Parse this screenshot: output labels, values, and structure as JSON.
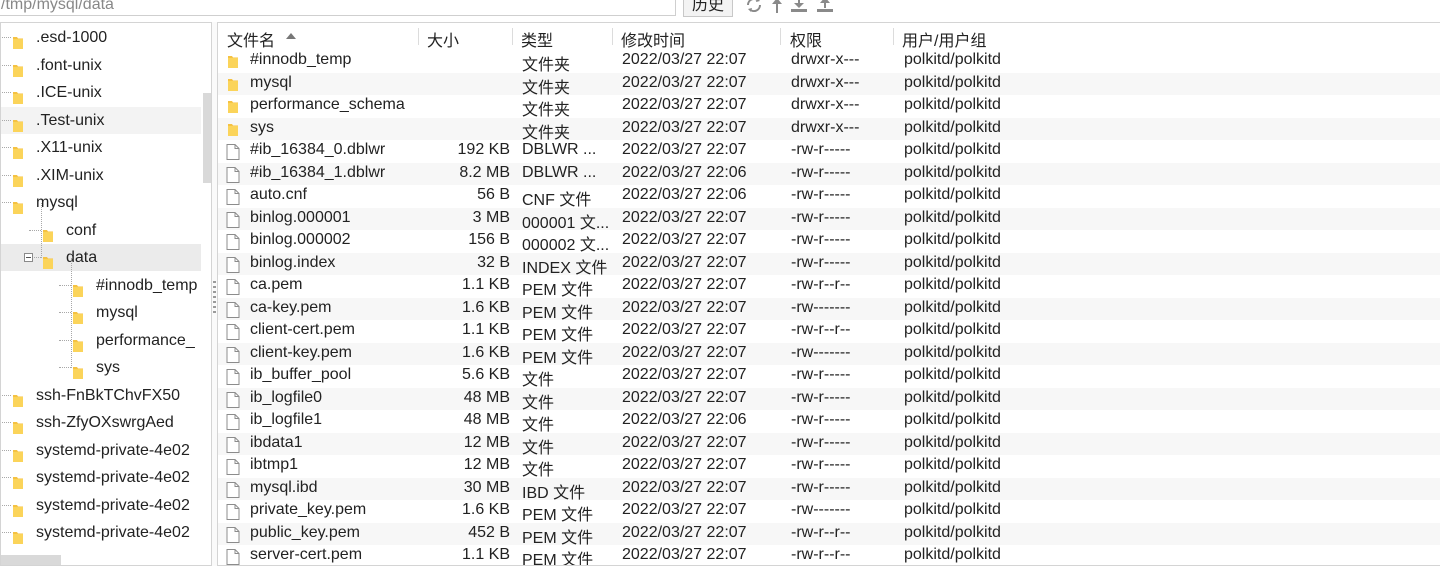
{
  "toolbar": {
    "path": "/tmp/mysql/data",
    "history_label": "历史",
    "icons": [
      "refresh-icon",
      "up-icon",
      "download-icon",
      "upload-icon"
    ]
  },
  "tree": [
    {
      "label": ".esd-1000",
      "depth": 0
    },
    {
      "label": ".font-unix",
      "depth": 0
    },
    {
      "label": ".ICE-unix",
      "depth": 0
    },
    {
      "label": ".Test-unix",
      "depth": 0,
      "highlight": true
    },
    {
      "label": ".X11-unix",
      "depth": 0
    },
    {
      "label": ".XIM-unix",
      "depth": 0
    },
    {
      "label": "mysql",
      "depth": 0
    },
    {
      "label": "conf",
      "depth": 1
    },
    {
      "label": "data",
      "depth": 1,
      "selected": true,
      "expanded": true
    },
    {
      "label": "#innodb_temp",
      "depth": 2
    },
    {
      "label": "mysql",
      "depth": 2
    },
    {
      "label": "performance_",
      "depth": 2
    },
    {
      "label": "sys",
      "depth": 2
    },
    {
      "label": "ssh-FnBkTChvFX50",
      "depth": 0
    },
    {
      "label": "ssh-ZfyOXswrgAed",
      "depth": 0
    },
    {
      "label": "systemd-private-4e02",
      "depth": 0
    },
    {
      "label": "systemd-private-4e02",
      "depth": 0
    },
    {
      "label": "systemd-private-4e02",
      "depth": 0
    },
    {
      "label": "systemd-private-4e02",
      "depth": 0
    }
  ],
  "columns": {
    "name": "文件名",
    "size": "大小",
    "type": "类型",
    "modified": "修改时间",
    "perm": "权限",
    "owner": "用户/用户组"
  },
  "files": [
    {
      "name": "#innodb_temp",
      "size": "",
      "type": "文件夹",
      "modified": "2022/03/27 22:07",
      "perm": "drwxr-x---",
      "owner": "polkitd/polkitd",
      "folder": true
    },
    {
      "name": "mysql",
      "size": "",
      "type": "文件夹",
      "modified": "2022/03/27 22:07",
      "perm": "drwxr-x---",
      "owner": "polkitd/polkitd",
      "folder": true
    },
    {
      "name": "performance_schema",
      "size": "",
      "type": "文件夹",
      "modified": "2022/03/27 22:07",
      "perm": "drwxr-x---",
      "owner": "polkitd/polkitd",
      "folder": true
    },
    {
      "name": "sys",
      "size": "",
      "type": "文件夹",
      "modified": "2022/03/27 22:07",
      "perm": "drwxr-x---",
      "owner": "polkitd/polkitd",
      "folder": true
    },
    {
      "name": "#ib_16384_0.dblwr",
      "size": "192 KB",
      "type": "DBLWR ...",
      "modified": "2022/03/27 22:07",
      "perm": "-rw-r-----",
      "owner": "polkitd/polkitd"
    },
    {
      "name": "#ib_16384_1.dblwr",
      "size": "8.2 MB",
      "type": "DBLWR ...",
      "modified": "2022/03/27 22:06",
      "perm": "-rw-r-----",
      "owner": "polkitd/polkitd"
    },
    {
      "name": "auto.cnf",
      "size": "56 B",
      "type": "CNF 文件",
      "modified": "2022/03/27 22:06",
      "perm": "-rw-r-----",
      "owner": "polkitd/polkitd"
    },
    {
      "name": "binlog.000001",
      "size": "3 MB",
      "type": "000001 文...",
      "modified": "2022/03/27 22:07",
      "perm": "-rw-r-----",
      "owner": "polkitd/polkitd"
    },
    {
      "name": "binlog.000002",
      "size": "156 B",
      "type": "000002 文...",
      "modified": "2022/03/27 22:07",
      "perm": "-rw-r-----",
      "owner": "polkitd/polkitd"
    },
    {
      "name": "binlog.index",
      "size": "32 B",
      "type": "INDEX 文件",
      "modified": "2022/03/27 22:07",
      "perm": "-rw-r-----",
      "owner": "polkitd/polkitd"
    },
    {
      "name": "ca.pem",
      "size": "1.1 KB",
      "type": "PEM 文件",
      "modified": "2022/03/27 22:07",
      "perm": "-rw-r--r--",
      "owner": "polkitd/polkitd"
    },
    {
      "name": "ca-key.pem",
      "size": "1.6 KB",
      "type": "PEM 文件",
      "modified": "2022/03/27 22:07",
      "perm": "-rw-------",
      "owner": "polkitd/polkitd"
    },
    {
      "name": "client-cert.pem",
      "size": "1.1 KB",
      "type": "PEM 文件",
      "modified": "2022/03/27 22:07",
      "perm": "-rw-r--r--",
      "owner": "polkitd/polkitd"
    },
    {
      "name": "client-key.pem",
      "size": "1.6 KB",
      "type": "PEM 文件",
      "modified": "2022/03/27 22:07",
      "perm": "-rw-------",
      "owner": "polkitd/polkitd"
    },
    {
      "name": "ib_buffer_pool",
      "size": "5.6 KB",
      "type": "文件",
      "modified": "2022/03/27 22:07",
      "perm": "-rw-r-----",
      "owner": "polkitd/polkitd"
    },
    {
      "name": "ib_logfile0",
      "size": "48 MB",
      "type": "文件",
      "modified": "2022/03/27 22:07",
      "perm": "-rw-r-----",
      "owner": "polkitd/polkitd"
    },
    {
      "name": "ib_logfile1",
      "size": "48 MB",
      "type": "文件",
      "modified": "2022/03/27 22:06",
      "perm": "-rw-r-----",
      "owner": "polkitd/polkitd"
    },
    {
      "name": "ibdata1",
      "size": "12 MB",
      "type": "文件",
      "modified": "2022/03/27 22:07",
      "perm": "-rw-r-----",
      "owner": "polkitd/polkitd"
    },
    {
      "name": "ibtmp1",
      "size": "12 MB",
      "type": "文件",
      "modified": "2022/03/27 22:07",
      "perm": "-rw-r-----",
      "owner": "polkitd/polkitd"
    },
    {
      "name": "mysql.ibd",
      "size": "30 MB",
      "type": "IBD 文件",
      "modified": "2022/03/27 22:07",
      "perm": "-rw-r-----",
      "owner": "polkitd/polkitd"
    },
    {
      "name": "private_key.pem",
      "size": "1.6 KB",
      "type": "PEM 文件",
      "modified": "2022/03/27 22:07",
      "perm": "-rw-------",
      "owner": "polkitd/polkitd"
    },
    {
      "name": "public_key.pem",
      "size": "452 B",
      "type": "PEM 文件",
      "modified": "2022/03/27 22:07",
      "perm": "-rw-r--r--",
      "owner": "polkitd/polkitd"
    },
    {
      "name": "server-cert.pem",
      "size": "1.1 KB",
      "type": "PEM 文件",
      "modified": "2022/03/27 22:07",
      "perm": "-rw-r--r--",
      "owner": "polkitd/polkitd"
    }
  ],
  "colors": {
    "folder": "#f5c242",
    "selection": "#ebebeb",
    "alt_row": "#f7f7f7"
  }
}
